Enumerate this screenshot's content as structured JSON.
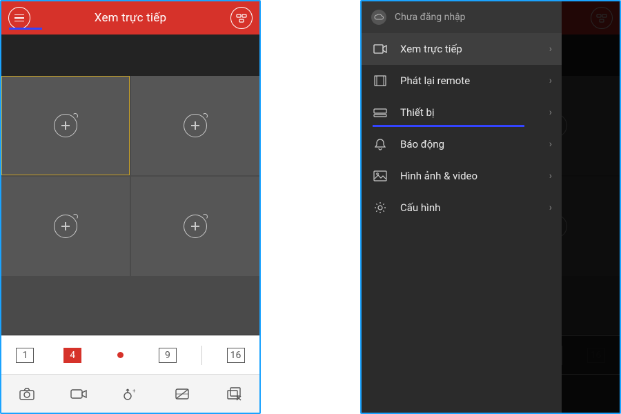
{
  "colors": {
    "accent": "#d6322a",
    "underline": "#3344ff"
  },
  "header": {
    "title": "Xem trực tiếp",
    "menu_icon": "menu-icon",
    "devices_icon": "devices-icon"
  },
  "grid": {
    "tiles": 4,
    "selected_index": 0
  },
  "layout_selector": {
    "options": [
      "1",
      "4",
      "9",
      "16"
    ],
    "active": "4",
    "record_dot": true
  },
  "toolbar": {
    "items": [
      "camera",
      "video-record",
      "ptz",
      "quality",
      "close-all"
    ]
  },
  "side_menu": {
    "login_status": "Chưa đăng nhập",
    "items": [
      {
        "icon": "liveview-icon",
        "label": "Xem trực tiếp",
        "selected": true
      },
      {
        "icon": "playback-icon",
        "label": "Phát lại remote",
        "selected": false
      },
      {
        "icon": "device-icon",
        "label": "Thiết bị",
        "selected": false
      },
      {
        "icon": "alarm-icon",
        "label": "Báo động",
        "selected": false
      },
      {
        "icon": "media-icon",
        "label": "Hình ảnh & video",
        "selected": false
      },
      {
        "icon": "settings-icon",
        "label": "Cấu hình",
        "selected": false
      }
    ]
  }
}
